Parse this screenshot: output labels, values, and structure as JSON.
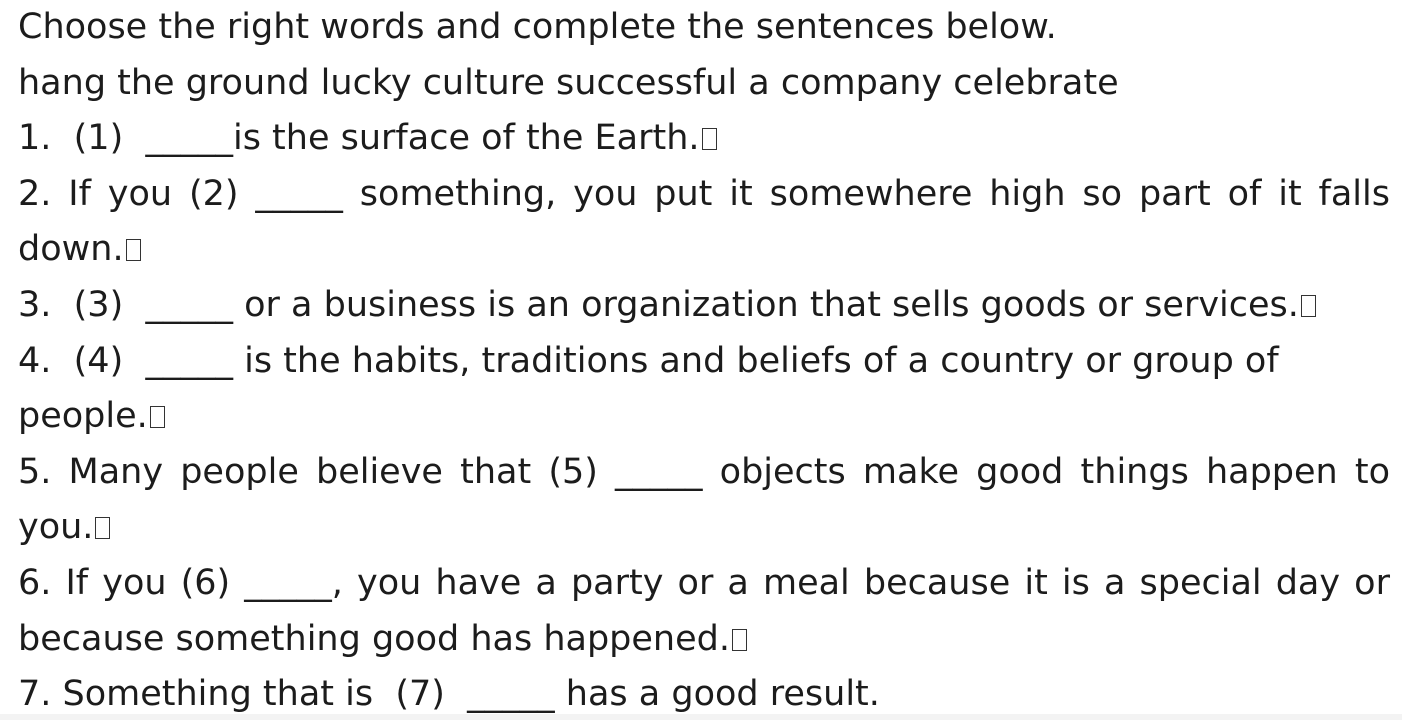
{
  "instruction": "Choose the right words and complete the sentences below.",
  "word_bank": "hang the ground lucky culture successful a company celebrate",
  "questions": [
    {
      "line1": "1.  (1)  _____is the surface of the Earth."
    },
    {
      "line1": "2. If you  (2)  _____ something, you put it somewhere high so part of it falls",
      "line2": "down."
    },
    {
      "line1": "3.  (3)  _____ or a business is an organization that sells goods or services."
    },
    {
      "line1": "4.  (4)  _____ is the habits, traditions and beliefs of a country or group of",
      "line2": "people."
    },
    {
      "line1": "5. Many people believe that  (5)  _____ objects make good things happen to",
      "line2": "you."
    },
    {
      "line1": "6. If you  (6)  _____, you have a party or a meal because it is a special day or",
      "line2": "because something good has happened."
    },
    {
      "line1": "7. Something that is  (7)  _____ has a good result."
    }
  ]
}
